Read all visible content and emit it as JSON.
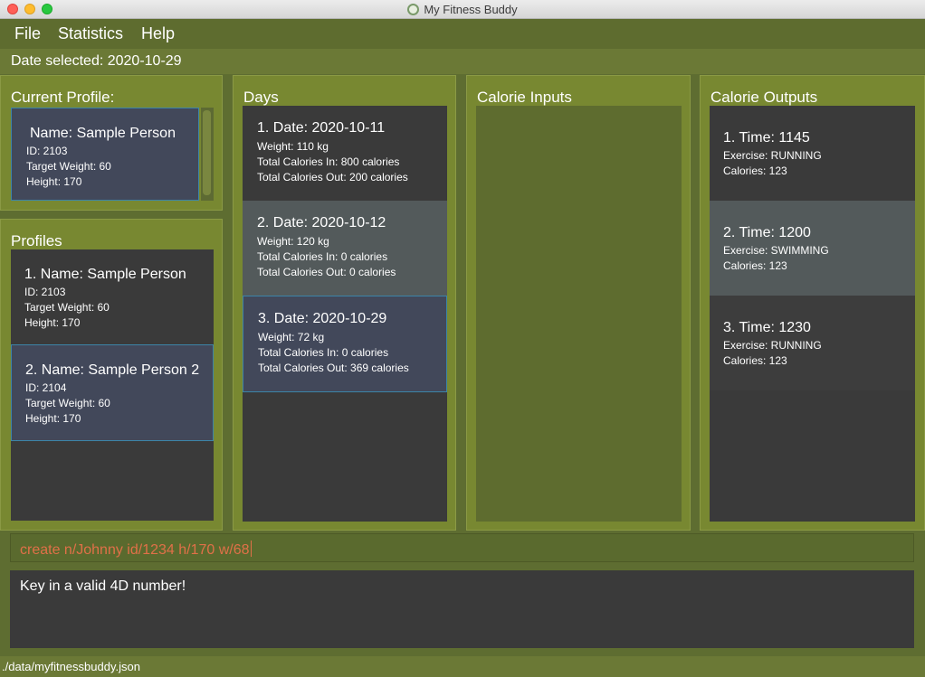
{
  "window": {
    "title": "My Fitness Buddy"
  },
  "menu": {
    "file": "File",
    "statistics": "Statistics",
    "help": "Help"
  },
  "date_selected": "Date selected: 2020-10-29",
  "current_profile": {
    "title": "Current Profile:",
    "name": "Name: Sample Person",
    "id": "ID: 2103",
    "target": "Target Weight: 60",
    "height": "Height: 170"
  },
  "profiles": {
    "title": "Profiles",
    "items": [
      {
        "head": "1.  Name: Sample Person",
        "id": "ID: 2103",
        "target": "Target Weight: 60",
        "height": "Height: 170"
      },
      {
        "head": "2.  Name: Sample Person 2",
        "id": "ID: 2104",
        "target": "Target Weight: 60",
        "height": "Height: 170"
      }
    ]
  },
  "days": {
    "title": "Days",
    "items": [
      {
        "head": "1.  Date: 2020-10-11",
        "weight": "Weight: 110 kg",
        "cal_in": "Total Calories In: 800 calories",
        "cal_out": "Total Calories Out: 200 calories"
      },
      {
        "head": "2.  Date: 2020-10-12",
        "weight": "Weight: 120 kg",
        "cal_in": "Total Calories In: 0 calories",
        "cal_out": "Total Calories Out: 0 calories"
      },
      {
        "head": "3.  Date: 2020-10-29",
        "weight": "Weight: 72 kg",
        "cal_in": "Total Calories In: 0 calories",
        "cal_out": "Total Calories Out: 369 calories"
      }
    ]
  },
  "calorie_inputs": {
    "title": "Calorie Inputs"
  },
  "calorie_outputs": {
    "title": "Calorie Outputs",
    "items": [
      {
        "head": "1.  Time: 1145",
        "exercise": "Exercise: RUNNING",
        "calories": "Calories: 123"
      },
      {
        "head": "2.  Time: 1200",
        "exercise": "Exercise: SWIMMING",
        "calories": "Calories: 123"
      },
      {
        "head": "3.  Time: 1230",
        "exercise": "Exercise: RUNNING",
        "calories": "Calories: 123"
      }
    ]
  },
  "command": {
    "value": "create n/Johnny id/1234 h/170 w/68"
  },
  "result": {
    "message": "Key in a valid 4D number!"
  },
  "status": {
    "file_path": "./data/myfitnessbuddy.json"
  }
}
